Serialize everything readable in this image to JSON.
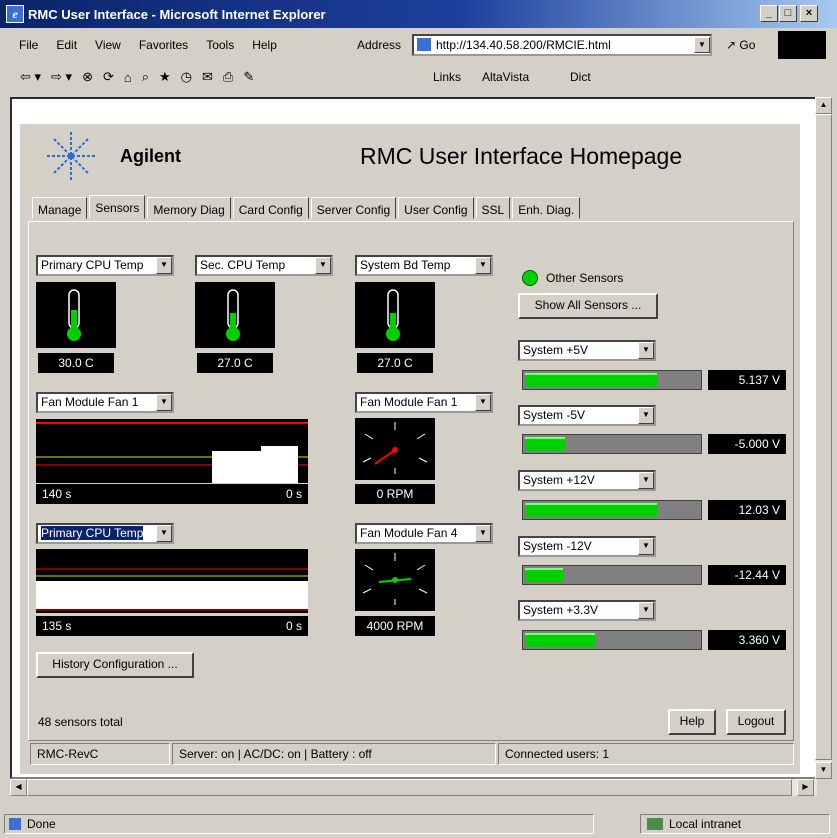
{
  "window": {
    "title": "RMC User Interface - Microsoft Internet Explorer"
  },
  "menu": [
    "File",
    "Edit",
    "View",
    "Favorites",
    "Tools",
    "Help"
  ],
  "address": {
    "label": "Address",
    "value": "http://134.40.58.200/RMCIE.html",
    "go": "Go"
  },
  "links": {
    "label": "Links",
    "items": [
      "AltaVista",
      "Dict"
    ]
  },
  "app": {
    "brand": "Agilent",
    "title": "RMC User Interface Homepage"
  },
  "tabs": [
    "Manage",
    "Sensors",
    "Memory Diag",
    "Card Config",
    "Server Config",
    "User Config",
    "SSL",
    "Enh. Diag."
  ],
  "temps": [
    {
      "select": "Primary CPU Temp",
      "value": "30.0 C"
    },
    {
      "select": "Sec. CPU Temp",
      "value": "27.0 C"
    },
    {
      "select": "System Bd Temp",
      "value": "27.0 C"
    }
  ],
  "fan_history": {
    "select": "Fan Module Fan 1",
    "left": "140 s",
    "right": "0 s"
  },
  "cpu_history": {
    "select": "Primary CPU Temp",
    "left": "135 s",
    "right": "0 s"
  },
  "fan_gauges": [
    {
      "select": "Fan Module Fan 1",
      "value": "0 RPM"
    },
    {
      "select": "Fan Module Fan 4",
      "value": "4000 RPM"
    }
  ],
  "history_button": "History Configuration ...",
  "other_sensors": {
    "label": "Other Sensors",
    "button": "Show All Sensors ..."
  },
  "voltages": [
    {
      "select": "System +5V",
      "value": "5.137 V",
      "fill": 0.76
    },
    {
      "select": "System -5V",
      "value": "-5.000 V",
      "fill": 0.23
    },
    {
      "select": "System +12V",
      "value": "12.03 V",
      "fill": 0.76
    },
    {
      "select": "System -12V",
      "value": "-12.44 V",
      "fill": 0.22
    },
    {
      "select": "System +3.3V",
      "value": "3.360 V",
      "fill": 0.4
    }
  ],
  "footer": {
    "count": "48 sensors total",
    "help": "Help",
    "logout": "Logout"
  },
  "appstatus": {
    "rev": "RMC-RevC",
    "server": "Server: on | AC/DC: on | Battery : off",
    "users": "Connected users: 1"
  },
  "ie_status": {
    "left": "Done",
    "zone": "Local intranet"
  },
  "colors": {
    "title_bar": "#0a246a",
    "sensor_green": "#00d000",
    "chart_red": "#ff0000",
    "chart_yellow": "#e0e000"
  }
}
